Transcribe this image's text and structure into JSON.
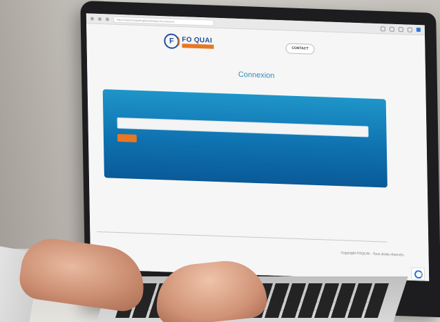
{
  "browser": {
    "url": "https://www.fosquairegistrationapp.fr/connexion"
  },
  "header": {
    "logo_name": "FO QUAI",
    "logo_band_text": "",
    "logo_tagline": "",
    "contact_label": "CONTACT"
  },
  "login": {
    "title": "Connexion",
    "panel_label": "",
    "input_placeholder": "",
    "submit_label": ""
  },
  "footer": {
    "link_1": "",
    "link_2": "",
    "copyright": "Copyright FOQUAI - Tous droits réservés"
  },
  "colors": {
    "brand_blue": "#1f4e9c",
    "brand_orange": "#e87722",
    "panel_blue": "#0f72b0",
    "title_blue": "#2d8fbf"
  }
}
